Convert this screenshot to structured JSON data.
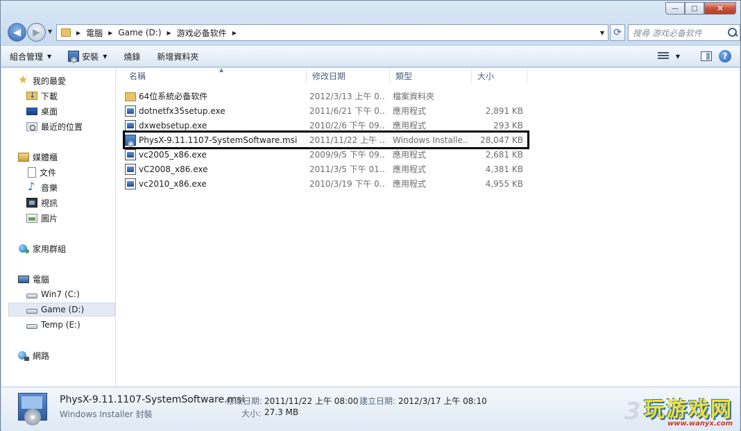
{
  "window": {
    "min_glyph": "—",
    "max_glyph": "□",
    "close_glyph": "✕"
  },
  "address_bar": {
    "crumbs": [
      "電腦",
      "Game (D:)",
      "游戏必备软件"
    ],
    "search_placeholder": "搜尋 游戏必备软件"
  },
  "toolbar": {
    "organize": "組合管理",
    "install": "安裝",
    "burn": "燒錄",
    "new_folder": "新增資料夾"
  },
  "nav": {
    "favorites": "我的最愛",
    "downloads": "下載",
    "desktop": "桌面",
    "recent": "最近的位置",
    "libraries": "媒體櫃",
    "documents": "文件",
    "music": "音樂",
    "videos": "視訊",
    "pictures": "圖片",
    "homegroup": "家用群組",
    "computer": "電腦",
    "drive_c": "Win7 (C:)",
    "drive_d": "Game (D:)",
    "drive_e": "Temp (E:)",
    "network": "網路"
  },
  "columns": {
    "name": "名稱",
    "date": "修改日期",
    "type": "類型",
    "size": "大小"
  },
  "files": [
    {
      "name": "64位系統必备软件",
      "date": "2012/3/13 上午 0...",
      "type": "檔案資料夾",
      "size": "",
      "kind": "folder"
    },
    {
      "name": "dotnetfx35setup.exe",
      "date": "2011/6/21 下午 0...",
      "type": "應用程式",
      "size": "2,891 KB",
      "kind": "exe"
    },
    {
      "name": "dxwebsetup.exe",
      "date": "2010/2/6 下午 09...",
      "type": "應用程式",
      "size": "293 KB",
      "kind": "exe"
    },
    {
      "name": "PhysX-9.11.1107-SystemSoftware.msi",
      "date": "2011/11/22 上午 ...",
      "type": "Windows Installe...",
      "size": "28,047 KB",
      "kind": "msi"
    },
    {
      "name": "vc2005_x86.exe",
      "date": "2009/9/5 下午 09...",
      "type": "應用程式",
      "size": "2,681 KB",
      "kind": "exe"
    },
    {
      "name": "vC2008_x86.exe",
      "date": "2011/3/5 下午 01...",
      "type": "應用程式",
      "size": "4,381 KB",
      "kind": "exe"
    },
    {
      "name": "vc2010_x86.exe",
      "date": "2010/3/19 下午 0...",
      "type": "應用程式",
      "size": "4,955 KB",
      "kind": "exe"
    }
  ],
  "details": {
    "name": "PhysX-9.11.1107-SystemSoftware.msi",
    "kind": "Windows Installer 封裝",
    "modified_label": "修改日期:",
    "modified_value": "2011/11/22 上午 08:00",
    "created_label": "建立日期:",
    "created_value": "2012/3/17 上午 08:10",
    "size_label": "大小:",
    "size_value": "27.3 MB"
  },
  "watermark": {
    "digit": "3",
    "main": "玩游戏网",
    "url": "www.wanyx.com"
  }
}
